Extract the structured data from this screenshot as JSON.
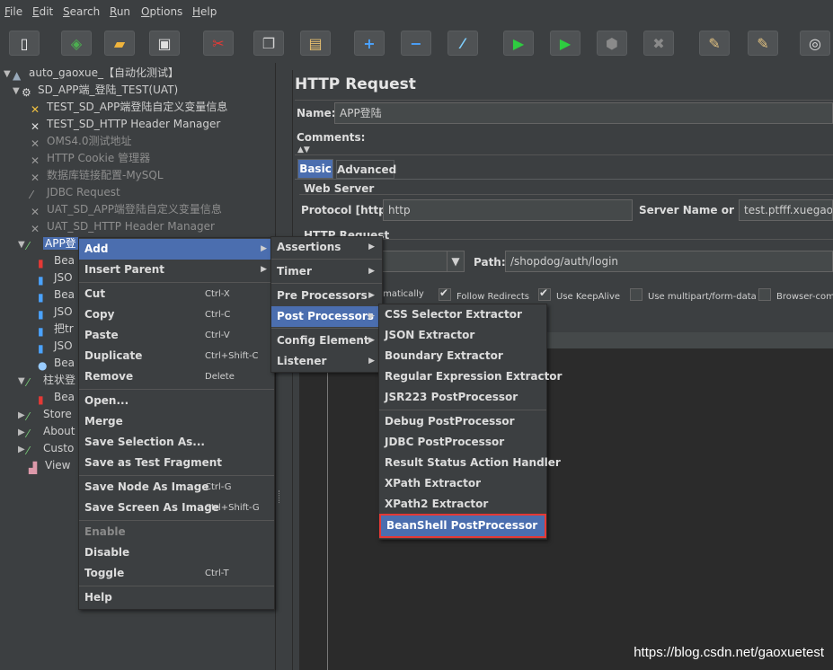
{
  "menubar": {
    "file": "File",
    "edit": "Edit",
    "search": "Search",
    "run": "Run",
    "options": "Options",
    "help": "Help"
  },
  "toolbar": {
    "icons": [
      "new-icon",
      "templates-icon",
      "open-icon",
      "save-icon",
      "cut-icon",
      "copy-icon",
      "paste-icon",
      "expand-icon",
      "collapse-icon",
      "toggle-icon",
      "start-icon",
      "start-no-pauses-icon",
      "stop-icon",
      "shutdown-icon",
      "clear-icon",
      "clear-all-icon",
      "search-icon"
    ]
  },
  "tree": {
    "root": "auto_gaoxue_【自动化测试】",
    "group": "SD_APP端_登陆_TEST(UAT)",
    "items": [
      "TEST_SD_APP端登陆自定义变量信息",
      "TEST_SD_HTTP Header Manager",
      "OMS4.0测试地址",
      "HTTP Cookie 管理器",
      "数据库链接配置-MySQL",
      "JDBC Request",
      "UAT_SD_APP端登陆自定义变量信息",
      "UAT_SD_HTTP Header Manager"
    ],
    "selected": "APP登",
    "children": [
      "Bea",
      "JSO",
      "Bea",
      "JSO",
      "把tr",
      "JSO",
      "Bea"
    ],
    "next_sampler": "柱状登",
    "next_child": "Bea",
    "others": [
      "Store",
      "About",
      "Custo",
      "View"
    ]
  },
  "context_menu": {
    "items": [
      {
        "label": "Add",
        "submenu": true
      },
      {
        "label": "Insert Parent",
        "submenu": true
      },
      {
        "label": "Cut",
        "shortcut": "Ctrl-X"
      },
      {
        "label": "Copy",
        "shortcut": "Ctrl-C"
      },
      {
        "label": "Paste",
        "shortcut": "Ctrl-V"
      },
      {
        "label": "Duplicate",
        "shortcut": "Ctrl+Shift-C"
      },
      {
        "label": "Remove",
        "shortcut": "Delete"
      },
      {
        "label": "Open..."
      },
      {
        "label": "Merge"
      },
      {
        "label": "Save Selection As..."
      },
      {
        "label": "Save as Test Fragment"
      },
      {
        "label": "Save Node As Image",
        "shortcut": "Ctrl-G"
      },
      {
        "label": "Save Screen As Image",
        "shortcut": "Ctrl+Shift-G"
      },
      {
        "label": "Enable"
      },
      {
        "label": "Disable"
      },
      {
        "label": "Toggle",
        "shortcut": "Ctrl-T"
      },
      {
        "label": "Help"
      }
    ]
  },
  "add_menu": {
    "items": [
      "Assertions",
      "Timer",
      "Pre Processors",
      "Post Processors",
      "Config Element",
      "Listener"
    ]
  },
  "post_menu": {
    "items": [
      "CSS Selector Extractor",
      "JSON Extractor",
      "Boundary Extractor",
      "Regular Expression Extractor",
      "JSR223 PostProcessor",
      "Debug PostProcessor",
      "JDBC PostProcessor",
      "Result Status Action Handler",
      "XPath Extractor",
      "XPath2 Extractor",
      "BeanShell PostProcessor"
    ]
  },
  "panel": {
    "title": "HTTP Request",
    "name_label": "Name:",
    "name_value": "APP登陆",
    "comments_label": "Comments:",
    "tab_basic": "Basic",
    "tab_advanced": "Advanced",
    "web_server": "Web Server",
    "protocol_label": "Protocol [http]:",
    "protocol_value": "http",
    "server_label": "Server Name or IP:",
    "server_value": "test.ptfff.xuegao.co",
    "http_request": "HTTP Request",
    "path_label": "Path:",
    "path_value": "/shopdog/auth/login",
    "opt_auto": "omatically",
    "opt_follow": "Follow Redirects",
    "opt_keepalive": "Use KeepAlive",
    "opt_multipart": "Use multipart/form-data",
    "opt_browser": "Browser-comp"
  },
  "watermark": "https://blog.csdn.net/gaoxuetest",
  "colors": {
    "background": "#3c3f41",
    "selection": "#4b6eaf",
    "highlight_border": "#e53935"
  }
}
